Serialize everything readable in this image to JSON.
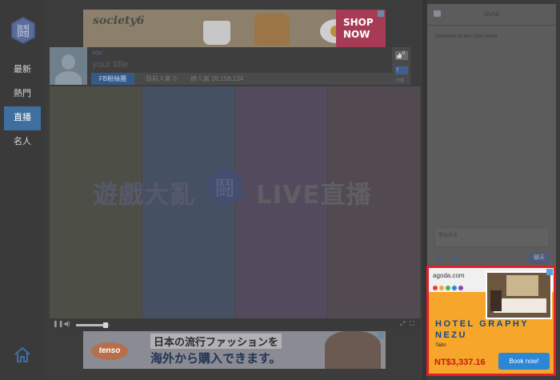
{
  "sidebar": {
    "items": [
      {
        "label": "最新"
      },
      {
        "label": "熱門"
      },
      {
        "label": "直播"
      },
      {
        "label": "名人"
      }
    ],
    "active_index": 2
  },
  "ads": {
    "top": {
      "brand": "society6",
      "cta": "SHOP NOW"
    },
    "bottom": {
      "brand": "tenso",
      "line1": "日本の流行ファッションを",
      "line2": "海外から購入できます。"
    },
    "side": {
      "logo": "agoda.com",
      "hotel_name": "HOTEL GRAPHY\nNEZU",
      "city": "Taito",
      "price": "NT$3,337.16",
      "cta": "Book now!"
    }
  },
  "stream": {
    "you_label": "YOU",
    "title": "your title",
    "fb_button": "FB粉絲團",
    "viewers_now": "目前人氣 0",
    "viewers_total": "總人氣 28,158,134",
    "like_count": "0",
    "share_label": "分享"
  },
  "video": {
    "logo_left": "遊戲大亂",
    "logo_right": "LIVE直播",
    "volume": 0.8
  },
  "chat": {
    "username": "sivhd",
    "welcome": "Welcome to the chat room!",
    "input_placeholder": "帶出訊息",
    "send_label": "聊天"
  },
  "colors": {
    "highlight": "#e0202a",
    "active_nav": "#3f6f9f",
    "agoda_orange": "#f6a62a",
    "book_blue": "#2b86d6"
  }
}
